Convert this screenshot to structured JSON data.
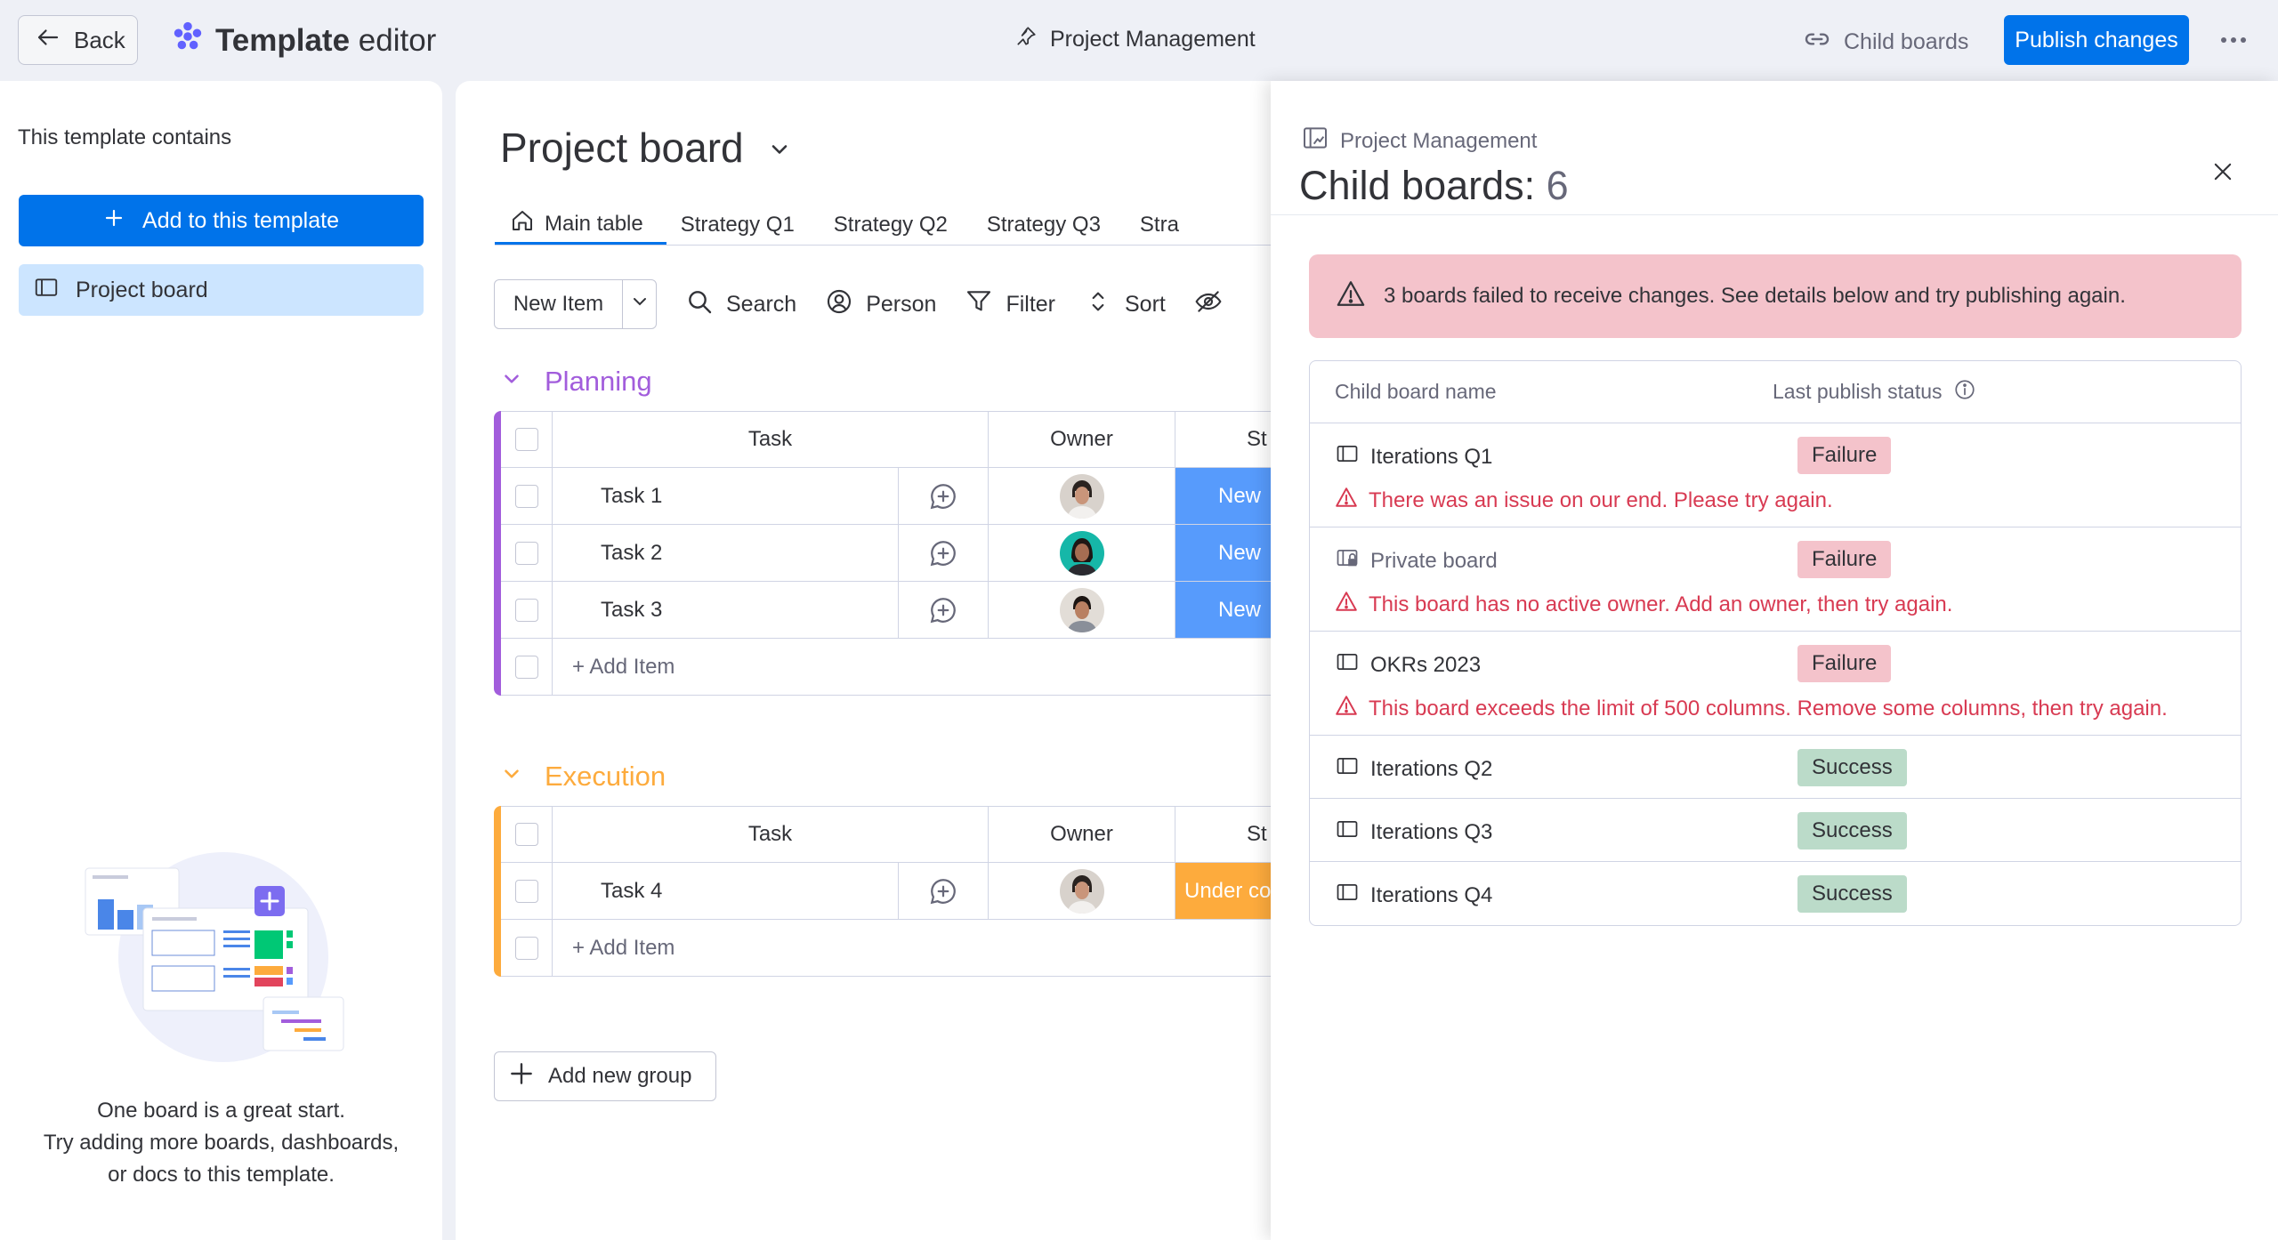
{
  "topbar": {
    "back_label": "Back",
    "brand_bold": "Template",
    "brand_rest": " editor",
    "center_title": "Project Management",
    "child_boards_label": "Child boards",
    "publish_label": "Publish changes"
  },
  "left_panel": {
    "heading": "This template contains",
    "add_button": "Add to this template",
    "item": "Project board",
    "message": [
      "One board is a great start.",
      "Try adding more boards, dashboards,",
      "or docs to this template."
    ]
  },
  "board": {
    "title": "Project board",
    "tabs": [
      "Main table",
      "Strategy Q1",
      "Strategy Q2",
      "Strategy Q3",
      "Stra"
    ],
    "toolbar": {
      "new_item": "New Item",
      "search": "Search",
      "person": "Person",
      "filter": "Filter",
      "sort": "Sort"
    },
    "columns": {
      "task": "Task",
      "owner": "Owner",
      "status": "St"
    },
    "groups": [
      {
        "name": "Planning",
        "color": "#a25ddc",
        "rows": [
          {
            "task": "Task 1",
            "status": "New",
            "status_color": "#579bfc"
          },
          {
            "task": "Task 2",
            "status": "New",
            "status_color": "#579bfc"
          },
          {
            "task": "Task 3",
            "status": "New",
            "status_color": "#579bfc"
          }
        ],
        "add_item": "+ Add Item"
      },
      {
        "name": "Execution",
        "color": "#fdab3d",
        "rows": [
          {
            "task": "Task 4",
            "status": "Under co",
            "status_color": "#fdab3d"
          }
        ],
        "add_item": "+ Add Item"
      }
    ],
    "add_group": "Add new group"
  },
  "child_panel": {
    "crumb": "Project Management",
    "title_label": "Child boards: ",
    "title_count": "6",
    "alert": "3 boards failed to receive changes. See details below and try publishing again.",
    "col_name": "Child board name",
    "col_status": "Last publish status",
    "rows": [
      {
        "name": "Iterations Q1",
        "status": "Failure",
        "error": "There was an issue on our end. Please try again."
      },
      {
        "name": "Private board",
        "status": "Failure",
        "error": "This board has no active owner. Add an owner, then try again."
      },
      {
        "name": "OKRs 2023",
        "status": "Failure",
        "error": "This board exceeds the limit of 500 columns. Remove some columns, then try again."
      },
      {
        "name": "Iterations Q2",
        "status": "Success"
      },
      {
        "name": "Iterations Q3",
        "status": "Success"
      },
      {
        "name": "Iterations Q4",
        "status": "Success"
      }
    ]
  }
}
